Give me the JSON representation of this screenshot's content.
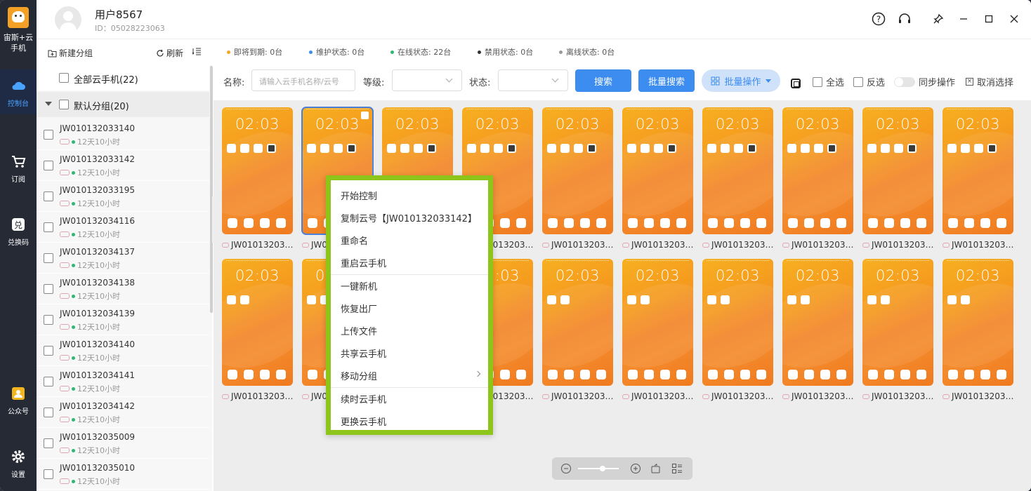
{
  "app": {
    "logo_line1": "宙斯+云",
    "logo_line2": "手机"
  },
  "rail": [
    {
      "label": "控制台",
      "icon": "cloud-icon"
    },
    {
      "label": "订阅",
      "icon": "cart-icon"
    },
    {
      "label": "兑换码",
      "icon": "redeem-icon"
    },
    {
      "label": "公众号",
      "icon": "official-account-icon"
    },
    {
      "label": "设置",
      "icon": "gear-icon"
    }
  ],
  "user": {
    "name": "用户8567",
    "id": "ID：05028223063"
  },
  "sidebar": {
    "new_group": "新建分组",
    "refresh": "刷新",
    "all_phones": "全部云手机(22)",
    "default_group": "默认分组(20)",
    "devices": [
      {
        "name": "JW010132033140",
        "time": "12天10小时"
      },
      {
        "name": "JW010132033142",
        "time": "12天10小时"
      },
      {
        "name": "JW010132033195",
        "time": "12天10小时"
      },
      {
        "name": "JW010132034116",
        "time": "12天10小时"
      },
      {
        "name": "JW010132034137",
        "time": "12天10小时"
      },
      {
        "name": "JW010132034138",
        "time": "12天10小时"
      },
      {
        "name": "JW010132034139",
        "time": "12天10小时"
      },
      {
        "name": "JW010132034140",
        "time": "12天10小时"
      },
      {
        "name": "JW010132034141",
        "time": "12天10小时"
      },
      {
        "name": "JW010132034142",
        "time": "12天10小时"
      },
      {
        "name": "JW010132035009",
        "time": "12天10小时"
      },
      {
        "name": "JW010132035010",
        "time": "12天10小时"
      }
    ]
  },
  "status": [
    {
      "label": "即将到期: 0台",
      "color": "#f5a623"
    },
    {
      "label": "维护状态: 0台",
      "color": "#3d8cf0"
    },
    {
      "label": "在线状态: 22台",
      "color": "#2eb872"
    },
    {
      "label": "禁用状态: 0台",
      "color": "#333333"
    },
    {
      "label": "离线状态: 0台",
      "color": "#999999"
    }
  ],
  "filters": {
    "name_label": "名称:",
    "name_placeholder": "请输入云手机名称/云号",
    "level_label": "等级:",
    "state_label": "状态:",
    "search": "搜索",
    "batch_search": "批量搜索",
    "batch_ops": "批量操作",
    "select_all": "全选",
    "invert": "反选",
    "sync": "同步操作",
    "cancel": "取消选择"
  },
  "phones": {
    "time": "02:03",
    "label": "JW01013203…",
    "count": 20,
    "selected_index": 1
  },
  "context_menu": {
    "items": [
      "开始控制",
      "复制云号【JW010132033142】",
      "重命名",
      "重启云手机",
      "一键新机",
      "恢复出厂",
      "上传文件",
      "共享云手机",
      "移动分组",
      "续时云手机",
      "更换云手机"
    ]
  },
  "colors": {
    "accent": "#3d8cf0",
    "menu_border": "#8dc51a",
    "rail_bg": "#262a35"
  }
}
